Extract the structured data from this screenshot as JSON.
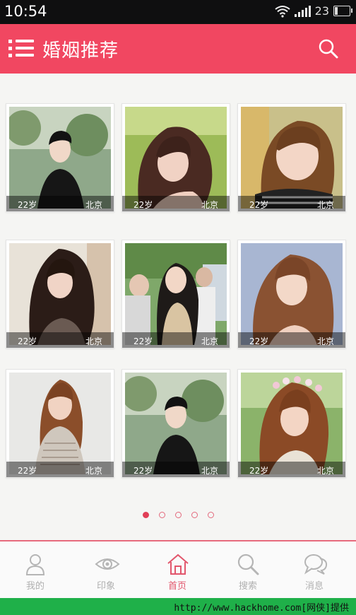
{
  "status_bar": {
    "time": "10:54",
    "battery": "23"
  },
  "app_bar": {
    "title": "婚姻推荐"
  },
  "profiles": [
    {
      "age": "22岁",
      "city": "北京"
    },
    {
      "age": "22岁",
      "city": "北京"
    },
    {
      "age": "22岁",
      "city": "北京"
    },
    {
      "age": "22岁",
      "city": "北京"
    },
    {
      "age": "22岁",
      "city": "北京"
    },
    {
      "age": "22岁",
      "city": "北京"
    },
    {
      "age": "22岁",
      "city": "北京"
    },
    {
      "age": "22岁",
      "city": "北京"
    },
    {
      "age": "22岁",
      "city": "北京"
    }
  ],
  "pager": {
    "count": 5,
    "active_index": 0
  },
  "tabs": [
    {
      "label": "我的",
      "icon": "person-icon"
    },
    {
      "label": "印象",
      "icon": "eye-icon"
    },
    {
      "label": "首页",
      "icon": "home-icon",
      "active": true
    },
    {
      "label": "搜索",
      "icon": "search-icon"
    },
    {
      "label": "消息",
      "icon": "chat-bubbles-icon"
    }
  ],
  "watermark": {
    "url": "http://www.hackhome.com[网侠]提供"
  },
  "colors": {
    "accent": "#f14761",
    "tab_active": "#e2566c",
    "tab_inactive": "#b0b0b0",
    "watermark_bg": "#1fb049"
  }
}
